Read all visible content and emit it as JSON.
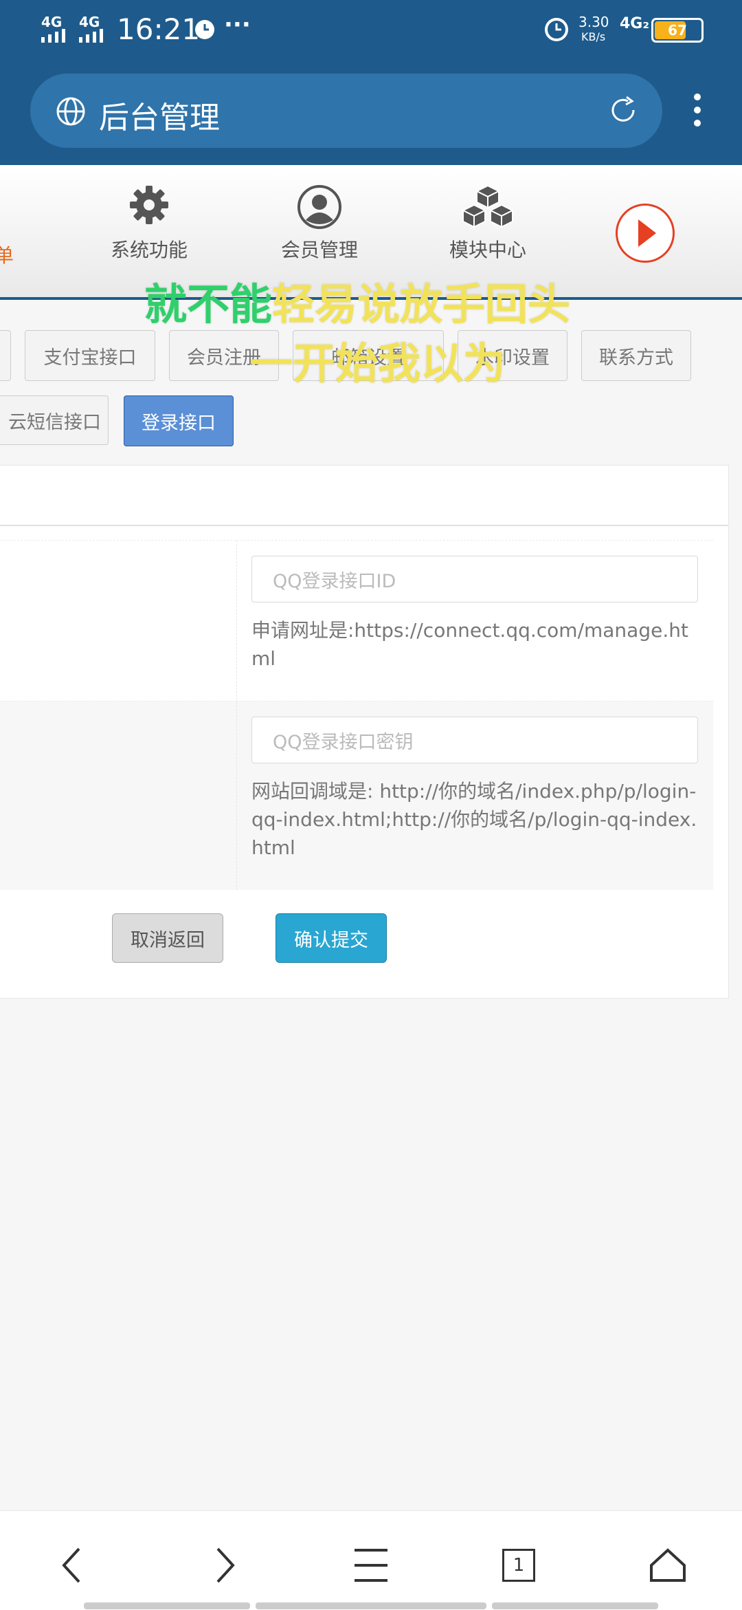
{
  "status_bar": {
    "time": "16:21",
    "network1": "4G",
    "network2": "4G",
    "speed_value": "3.30",
    "speed_unit": "KB/s",
    "network3": "4G₂",
    "battery": "67",
    "more": "···"
  },
  "browser": {
    "title": "后台管理"
  },
  "nav": {
    "prev_partial": "单",
    "items": [
      {
        "label": "系统功能",
        "icon": "gear-icon"
      },
      {
        "label": "会员管理",
        "icon": "user-icon"
      },
      {
        "label": "模块中心",
        "icon": "cubes-icon"
      }
    ]
  },
  "tabs": {
    "row1": [
      "支付宝接口",
      "会员注册",
      "邮箱设置",
      "水印设置",
      "联系方式"
    ],
    "row2": [
      "云短信接口",
      "登录接口"
    ],
    "active": "登录接口"
  },
  "form": {
    "field1_placeholder": "QQ登录接口ID",
    "field1_help": "申请网址是:https://connect.qq.com/manage.html",
    "field2_placeholder": "QQ登录接口密钥",
    "field2_help": "网站回调域是: http://你的域名/index.php/p/login-qq-index.html;http://你的域名/p/login-qq-index.html",
    "cancel": "取消返回",
    "submit": "确认提交"
  },
  "overlay": {
    "line1_green": "就不能",
    "line1_yellow": "轻易说放手回头",
    "line2": "一开始我以为"
  },
  "bottom_bar": {
    "tab_count": "1"
  },
  "colors": {
    "header": "#1e5b8c",
    "active_tab": "#5b8fd6",
    "submit": "#29a6d2",
    "lyric_green": "#2fd06b",
    "lyric_yellow": "#f2e25a"
  }
}
